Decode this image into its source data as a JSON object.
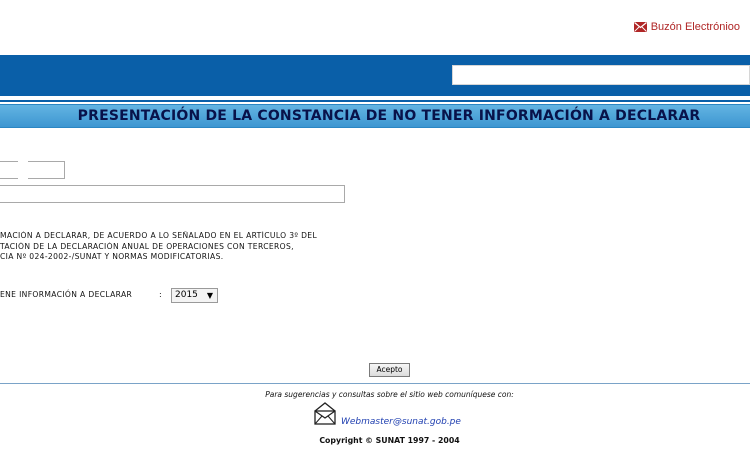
{
  "header": {
    "mailbox_label": "Buzón Electrónioo"
  },
  "title_bar": {
    "title": "PRESENTACIÓN DE LA CONSTANCIA DE NO TENER INFORMACIÓN A DECLARAR"
  },
  "form": {
    "short_field_value": "",
    "long_field_value": "",
    "legal_lines": [
      "MACIÓN A DECLARAR, DE ACUERDO A LO SEÑALADO EN EL ARTÍCULO 3º DEL",
      "TACIÓN DE LA DECLARACIÓN ANUAL DE OPERACIONES CON TERCEROS,",
      "CIA Nº 024-2002-/SUNAT Y NORMAS MODIFICATORIAS."
    ],
    "year_label": "ENE INFORMACIÓN A DECLARAR",
    "year_colon": ":",
    "year_selected": "2015",
    "year_arrow": "▼",
    "accept_label": "Acepto"
  },
  "footer": {
    "note": "Para sugerencias y consultas sobre el sitio web comuníquese con:",
    "email": "Webmaster@sunat.gob.pe",
    "copyright": "Copyright © SUNAT 1997 - 2004"
  },
  "colors": {
    "top_bar": "#0a5fa8",
    "title_bar": "#3d96d1",
    "title_text": "#08124a",
    "mailbox_text": "#b02626",
    "link": "#1f3fb0"
  }
}
